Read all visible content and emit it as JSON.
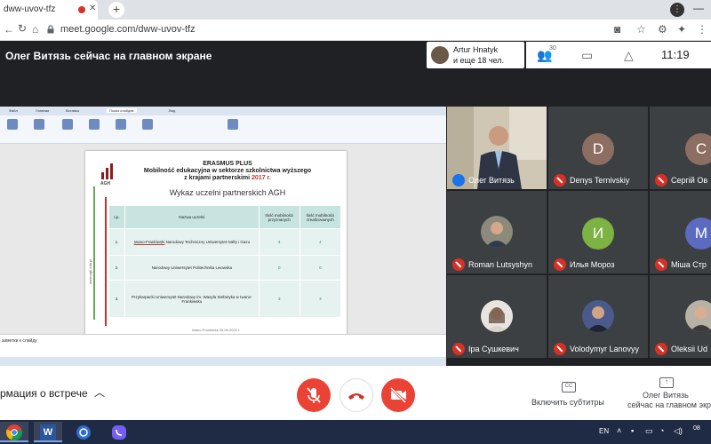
{
  "browser": {
    "tab_title": "dww-uvov-tfz",
    "new_tab_label": "+",
    "url": "meet.google.com/dww-uvov-tfz"
  },
  "meet": {
    "presenter_banner": "Олег Витязь сейчас на главном экране",
    "host_name": "Artur Hnatyk",
    "host_others": "и еще 18 чел.",
    "participant_count_badge": "30",
    "clock": "11:19"
  },
  "slide": {
    "logo_text": "AGH",
    "title_line1": "ERASMUS PLUS",
    "title_line2": "Mobilność edukacyjna w sektorze szkolnictwa wyższego",
    "title_line3_prefix": "z krajami partnerskimi",
    "title_year": "2017 r.",
    "subtitle": "Wykaz uczelni partnerskich AGH",
    "table": {
      "headers": [
        "Lp.",
        "Nazwa uczelni",
        "Ilość mobilności przyznanych",
        "Ilość mobilności zrealizowanych"
      ],
      "rows": [
        {
          "lp": "1.",
          "name_underlined": "Iwano-Frankiwski",
          "name_rest": "Narodowy Techniczny Uniwersytet Nafty i Gazu",
          "granted": "4",
          "realized": "4"
        },
        {
          "lp": "2.",
          "name_underlined": "",
          "name_rest": "Narodowy Uniwersytet Politechnika Lwowska",
          "granted": "0",
          "realized": "0"
        },
        {
          "lp": "3.",
          "name_underlined": "",
          "name_rest": "Przykarpacki Uniwersytet Narodowy im. Wasyla Stefanyka w Iwano-Frankiwsku",
          "granted": "3",
          "realized": "3"
        }
      ]
    },
    "footer": "Iwano-Frankiwsk 08.06.2021 r.",
    "vertical_url": "www.agh.edu.pl",
    "notes_text": "заметки к слайду"
  },
  "participants": [
    {
      "name": "Олег Витязь",
      "type": "video"
    },
    {
      "name": "Denys Ternivskiy",
      "initial": "D",
      "color": "#8d6e63"
    },
    {
      "name": "Сергій Ов",
      "initial": "С",
      "color": "#8d6e63"
    },
    {
      "name": "Roman Lutsyshyn",
      "type": "photo"
    },
    {
      "name": "Илья Мороз",
      "initial": "И",
      "color": "#7cb342"
    },
    {
      "name": "Міша Стр",
      "initial": "М",
      "color": "#5c6bc0"
    },
    {
      "name": "Іра Сушкевич",
      "type": "photo"
    },
    {
      "name": "Volodymyr Lanovyy",
      "type": "photo"
    },
    {
      "name": "Oleksii Ud",
      "type": "photo"
    }
  ],
  "bottombar": {
    "meeting_info": "рмация о встрече",
    "captions_label": "Включить субтитры",
    "presenting_line1": "Олег Витязь",
    "presenting_line2": "сейчас на главном экра"
  },
  "taskbar": {
    "lang": "EN",
    "time": "08"
  },
  "colors": {
    "meet_bg": "#202124",
    "tile_bg": "#3c4043",
    "mute_red": "#d93025",
    "end_call_red": "#ea4335"
  }
}
